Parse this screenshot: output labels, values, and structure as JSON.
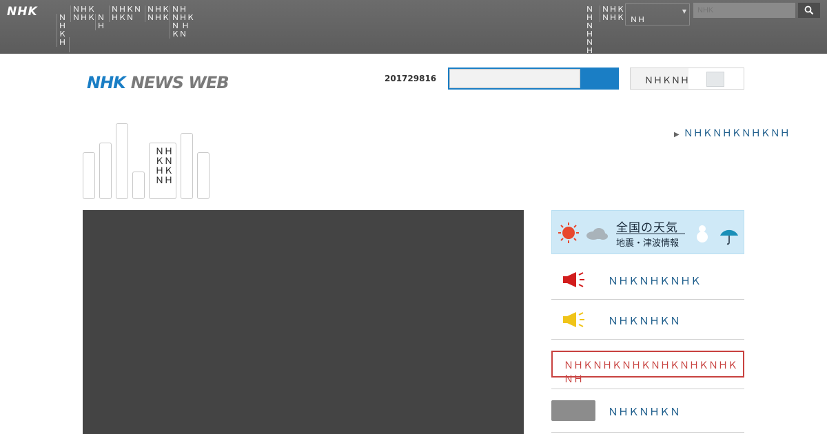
{
  "topbar": {
    "logo": "NHK",
    "nav": [
      {
        "label": "ＮＨ ＫＨ"
      },
      {
        "label": "ＮＨＫ ＮＨＫ"
      },
      {
        "label": "ＮＨ"
      },
      {
        "label": "ＮＨＫＮ ＨＫＮ"
      },
      {
        "label": "ＮＨＫ ＮＨＫ"
      },
      {
        "label": "ＮＨ ＮＨＫＮ ＨＫＮ"
      }
    ],
    "right_nav": [
      {
        "label": "ＮＨ ＮＨ ＮＨ"
      },
      {
        "label": "ＮＨＫ ＮＨＫ"
      }
    ],
    "region_value": "ＮＨ",
    "search_placeholder": "NHK"
  },
  "header": {
    "logo_nhk": "NHK",
    "logo_news": "NEWS WEB",
    "date": "201729816",
    "tool_label": "ＮＨＫＮＨＫ"
  },
  "bars": {
    "label": "ＮＨＫＮＨＫＮＨ"
  },
  "notice_link": "ＮＨＫＮＨＫＮＨＫＮＨ",
  "weather": {
    "title": "全国の天気",
    "subtitle": "地震・津波情報"
  },
  "side_links": [
    {
      "label": "ＮＨＫＮＨＫＮＨＫ"
    },
    {
      "label": "ＮＨＫＮＨＫＮ"
    }
  ],
  "alert_box": "ＮＨＫＮＨＫＮＨＫＮＨＫＮＨＫＮＨＫＮＨ",
  "bottom_link": "ＮＨＫＮＨＫＮ",
  "colors": {
    "brand_blue": "#1a7ec5",
    "link_blue": "#1a5b8a",
    "alert_red": "#c8413f"
  }
}
